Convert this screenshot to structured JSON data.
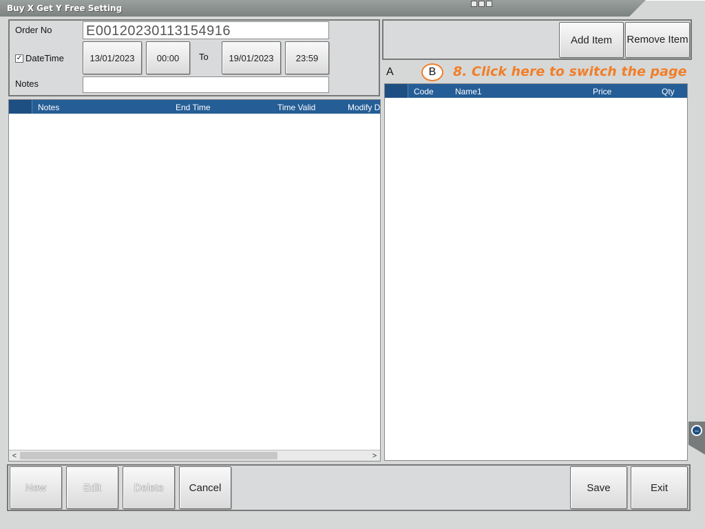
{
  "window": {
    "title": "Buy X Get Y Free Setting"
  },
  "header": {
    "order_no_label": "Order No",
    "order_no_value": "E00120230113154916",
    "datetime_label": "DateTime",
    "datetime_checked": true,
    "start_date": "13/01/2023",
    "start_time": "00:00",
    "to_label": "To",
    "end_date": "19/01/2023",
    "end_time": "23:59",
    "notes_label": "Notes",
    "notes_value": ""
  },
  "left_grid": {
    "columns": [
      "Notes",
      "End Time",
      "Time Valid",
      "Modify D"
    ],
    "rows": []
  },
  "right_toolbar": {
    "add_item": "Add Item",
    "remove_item": "Remove Item"
  },
  "page_tabs": {
    "a": "A",
    "b": "B",
    "hint": "8. Click here to switch the page"
  },
  "right_grid": {
    "columns": [
      "Code",
      "Name1",
      "Price",
      "Qty"
    ],
    "rows": []
  },
  "bottom_bar": {
    "new": "New",
    "edit": "Edit",
    "delete": "Delete",
    "cancel": "Cancel",
    "save": "Save",
    "exit": "Exit"
  },
  "icons": {
    "scroll_left": "chevron-left-icon",
    "scroll_right": "chevron-right-icon",
    "side_handle": "side-drawer-icon"
  },
  "colors": {
    "grid_header": "#255d96",
    "hint": "#f07e2a"
  }
}
